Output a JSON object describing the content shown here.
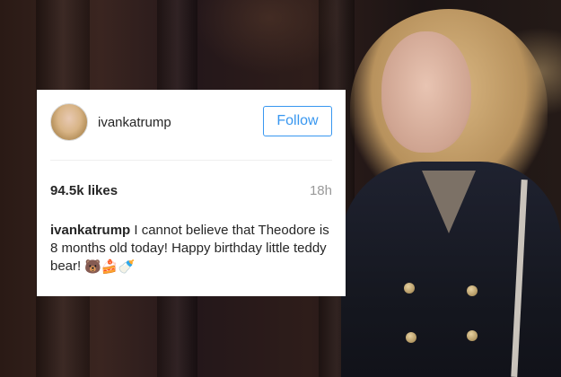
{
  "post": {
    "username": "ivankatrump",
    "follow_label": "Follow",
    "likes": "94.5k likes",
    "time_ago": "18h",
    "caption_user": "ivankatrump",
    "caption_text": "I cannot believe that Theodore is 8 months old today! Happy birthday little teddy bear!",
    "caption_emojis": "🐻🍰🍼"
  },
  "colors": {
    "follow_blue": "#3897f0",
    "text": "#262626",
    "muted": "#999999"
  }
}
